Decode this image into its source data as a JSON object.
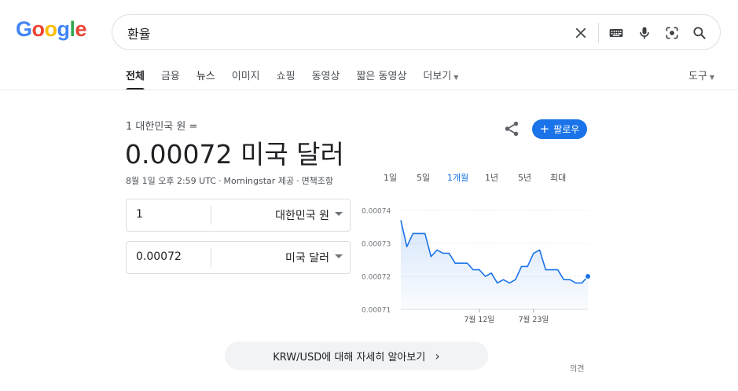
{
  "logo": {
    "letters": [
      "G",
      "o",
      "o",
      "g",
      "l",
      "e"
    ],
    "colors": [
      "#4285F4",
      "#EA4335",
      "#FBBC05",
      "#4285F4",
      "#34A853",
      "#EA4335"
    ]
  },
  "search": {
    "query": "환율",
    "icons": [
      "clear-icon",
      "keyboard-icon",
      "mic-icon",
      "lens-icon",
      "search-icon"
    ]
  },
  "tabs": [
    {
      "label": "전체",
      "active": true
    },
    {
      "label": "금융"
    },
    {
      "label": "뉴스",
      "dark": true
    },
    {
      "label": "이미지"
    },
    {
      "label": "쇼핑"
    },
    {
      "label": "동영상"
    },
    {
      "label": "짧은 동영상"
    },
    {
      "label": "더보기",
      "caret": "▼"
    }
  ],
  "tools_label": "도구",
  "caret": "▼",
  "currency": {
    "from_line": "1 대한민국 원 =",
    "result": "0.00072 미국 달러",
    "meta": {
      "date": "8월 1일 오후 2:59 UTC",
      "source": "Morningstar 제공",
      "disclaimer": "면책조항",
      "dot": "·"
    },
    "follow_label": "팔로우",
    "follow_plus": "+",
    "inputs": [
      {
        "value": "1",
        "currency": "대한민국 원"
      },
      {
        "value": "0.00072",
        "currency": "미국 달러"
      }
    ]
  },
  "ranges": [
    {
      "label": "1일"
    },
    {
      "label": "5일"
    },
    {
      "label": "1개월",
      "active": true
    },
    {
      "label": "1년"
    },
    {
      "label": "5년"
    },
    {
      "label": "최대"
    }
  ],
  "chart_data": {
    "type": "area",
    "color": "#1a73e8",
    "ylim": [
      0.00071,
      0.00074
    ],
    "y_ticks": [
      "0.00074",
      "0.00073",
      "0.00072",
      "0.00071"
    ],
    "y_tick_values": [
      0.00074,
      0.00073,
      0.00072,
      0.00071
    ],
    "x_ticks": [
      "7월 12일",
      "7월 23일"
    ],
    "values": [
      0.000737,
      0.000729,
      0.000733,
      0.000733,
      0.000733,
      0.000726,
      0.000728,
      0.000727,
      0.000727,
      0.000724,
      0.000724,
      0.000724,
      0.000722,
      0.000722,
      0.00072,
      0.000721,
      0.000718,
      0.000719,
      0.000718,
      0.000719,
      0.000723,
      0.000723,
      0.000727,
      0.000728,
      0.000722,
      0.000722,
      0.000722,
      0.000719,
      0.000719,
      0.000718,
      0.000718,
      0.00072
    ]
  },
  "more_button": {
    "label": "KRW/USD에 대해 자세히 알아보기",
    "chevron": "›"
  },
  "feedback_label": "의견"
}
